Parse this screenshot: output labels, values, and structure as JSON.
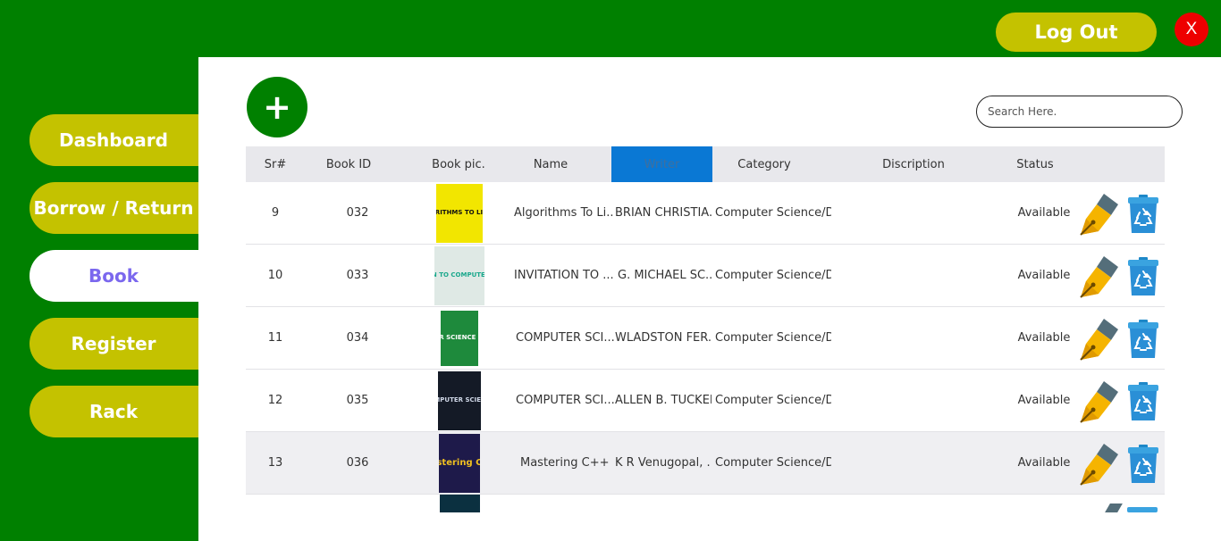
{
  "header": {
    "logout_label": "Log Out",
    "close_label": "X"
  },
  "sidebar": {
    "items": [
      {
        "label": "Dashboard"
      },
      {
        "label": "Borrow / Return"
      },
      {
        "label": "Book"
      },
      {
        "label": "Register"
      },
      {
        "label": "Rack"
      }
    ],
    "active": "Book"
  },
  "toolbar": {
    "add_label": "+",
    "search_placeholder": "Search Here."
  },
  "table": {
    "columns": [
      "Sr#",
      "Book ID",
      "Book pic.",
      "Name",
      "Writer",
      "Category",
      "Discription",
      "Status"
    ],
    "selected_column": "Writer",
    "rows": [
      {
        "sr": "9",
        "book_id": "032",
        "name": "Algorithms To Li...",
        "writer": "BRIAN CHRISTIA...",
        "category": "Computer Science/D...",
        "description": "",
        "status": "Available",
        "cover_text": "ALGORITHMS TO LIVE BY"
      },
      {
        "sr": "10",
        "book_id": "033",
        "name": "INVITATION TO ...",
        "writer": "G. MICHAEL SC...",
        "category": "Computer Science/D...",
        "description": "",
        "status": "Available",
        "cover_text": "INVITATION TO COMPUTER SCIENCE"
      },
      {
        "sr": "11",
        "book_id": "034",
        "name": "COMPUTER SCI...",
        "writer": "WLADSTON FER...",
        "category": "Computer Science/D...",
        "description": "",
        "status": "Available",
        "cover_text": "COMPUTER SCIENCE DISTILLED"
      },
      {
        "sr": "12",
        "book_id": "035",
        "name": "COMPUTER SCI...",
        "writer": "ALLEN B. TUCKER",
        "category": "Computer Science/D...",
        "description": "",
        "status": "Available",
        "cover_text": "COMPUTER SCIENCE"
      },
      {
        "sr": "13",
        "book_id": "036",
        "name": "Mastering C++",
        "writer": "K R Venugopal, ...",
        "category": "Computer Science/D...",
        "description": "",
        "status": "Available",
        "cover_text": "Mastering C++"
      }
    ]
  },
  "colors": {
    "app_green": "#008000",
    "nav_olive": "#c4c200",
    "active_nav_text": "#7b68ee",
    "close_red": "#ee0000",
    "selected_header": "#0a78d4",
    "cover_colors": [
      "#f2e600",
      "#dfe9e5",
      "#1e8a3c",
      "#141a26",
      "#1e1a4a"
    ]
  },
  "icons": {
    "edit": "fountain-pen-icon",
    "delete": "recycle-bin-icon"
  }
}
